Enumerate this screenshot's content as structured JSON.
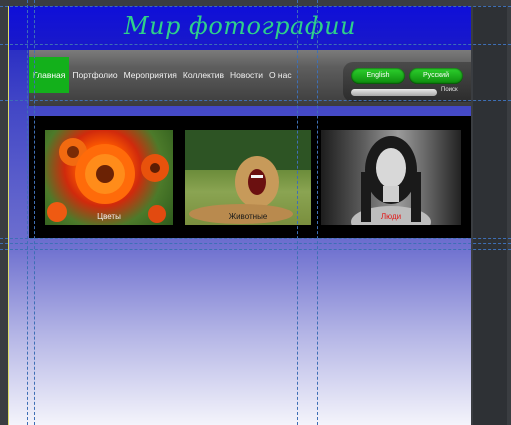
{
  "header": {
    "title": "Мир фотографии"
  },
  "nav": {
    "items": [
      {
        "label": "Главная",
        "active": true
      },
      {
        "label": "Портфолио",
        "active": false
      },
      {
        "label": "Мероприятия",
        "active": false
      },
      {
        "label": "Коллектив",
        "active": false
      },
      {
        "label": "Новости",
        "active": false
      },
      {
        "label": "О нас",
        "active": false
      }
    ]
  },
  "language": {
    "english_label": "English",
    "russian_label": "Русский"
  },
  "search": {
    "label": "Поиск"
  },
  "gallery": {
    "items": [
      {
        "caption": "Цветы"
      },
      {
        "caption": "Животные"
      },
      {
        "caption": "Люди"
      }
    ]
  },
  "colors": {
    "header_bg": "#1010d0",
    "title_text": "#2fd08a",
    "active_nav": "#13b01b",
    "lang_button": "#1fb01f",
    "guide_lines": "#3e6fb5"
  }
}
